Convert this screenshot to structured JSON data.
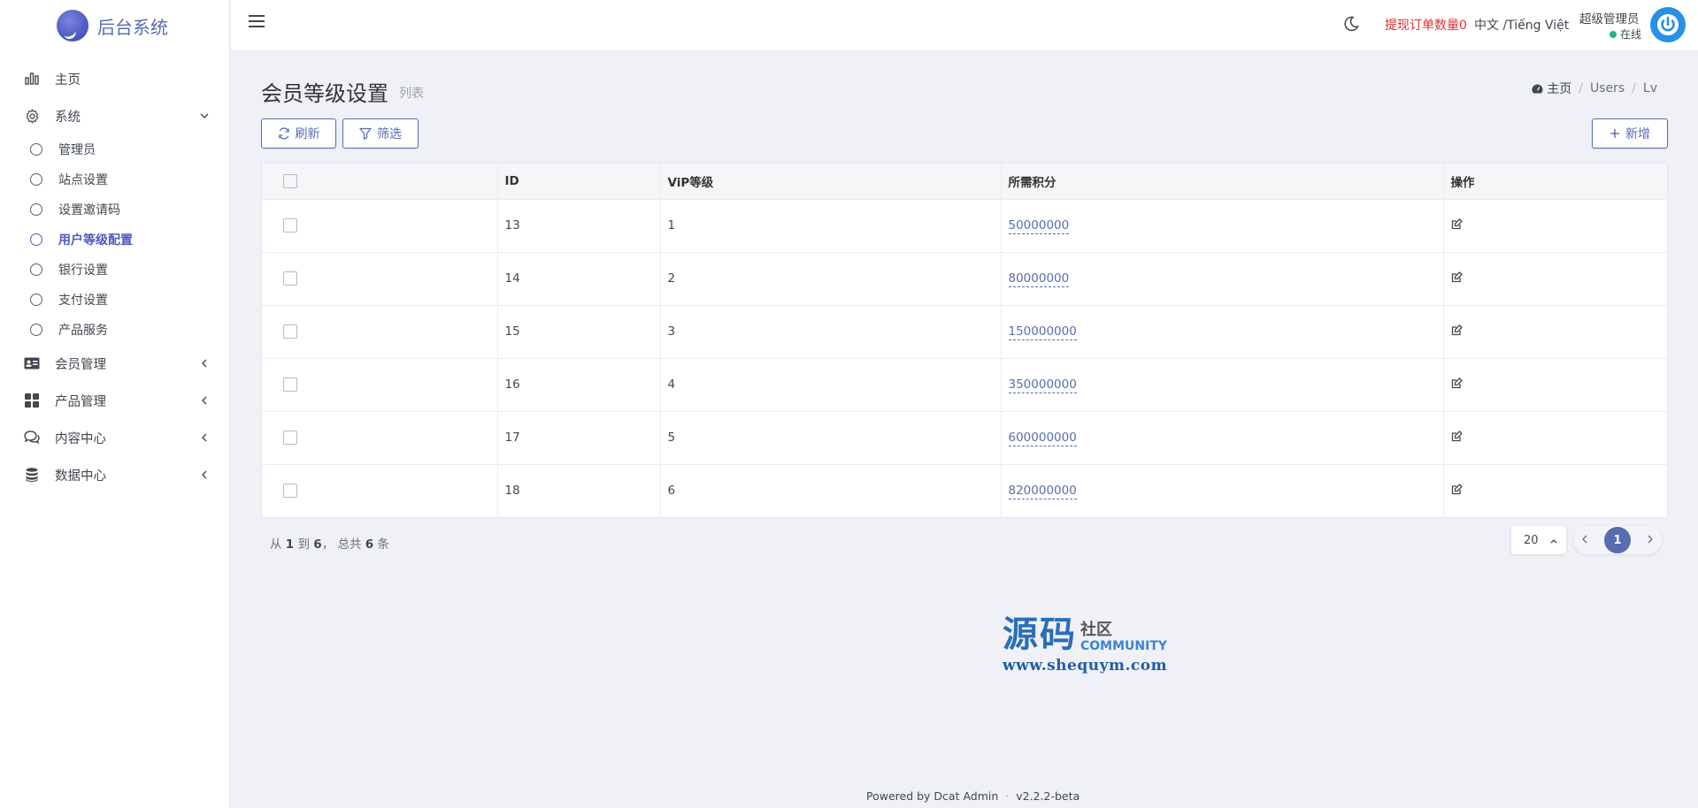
{
  "brand": {
    "name": "后台系统"
  },
  "sidebar": {
    "items": [
      {
        "label": "主页",
        "icon": "bar-chart-icon"
      },
      {
        "label": "系统",
        "icon": "gear-icon",
        "expanded": true,
        "children": [
          {
            "label": "管理员"
          },
          {
            "label": "站点设置"
          },
          {
            "label": "设置邀请码"
          },
          {
            "label": "用户等级配置",
            "active": true
          },
          {
            "label": "银行设置"
          },
          {
            "label": "支付设置"
          },
          {
            "label": "产品服务"
          }
        ]
      },
      {
        "label": "会员管理",
        "icon": "id-card-icon"
      },
      {
        "label": "产品管理",
        "icon": "grid-icon"
      },
      {
        "label": "内容中心",
        "icon": "chat-icon"
      },
      {
        "label": "数据中心",
        "icon": "database-icon"
      }
    ]
  },
  "header": {
    "withdraw_label": "提现订单数量0",
    "language": "中文 /Tiếng Việt",
    "user_name": "超级管理员",
    "user_status": "在线"
  },
  "page": {
    "title": "会员等级设置",
    "subtitle": "列表",
    "breadcrumb": [
      "主页",
      "Users",
      "Lv"
    ]
  },
  "toolbar": {
    "refresh_label": "刷新",
    "filter_label": "筛选",
    "new_label": "新增"
  },
  "table": {
    "columns": [
      "ID",
      "ViP等级",
      "所需积分",
      "操作"
    ],
    "rows": [
      {
        "id": "13",
        "level": "1",
        "points": "50000000"
      },
      {
        "id": "14",
        "level": "2",
        "points": "80000000"
      },
      {
        "id": "15",
        "level": "3",
        "points": "150000000"
      },
      {
        "id": "16",
        "level": "4",
        "points": "350000000"
      },
      {
        "id": "17",
        "level": "5",
        "points": "600000000"
      },
      {
        "id": "18",
        "level": "6",
        "points": "820000000"
      }
    ]
  },
  "pagination": {
    "summary_from": "从",
    "from": "1",
    "summary_to": "到",
    "to": "6",
    "summary_total": "，  总共",
    "total": "6",
    "summary_unit": "条",
    "per_page": "20",
    "current_page": "1"
  },
  "watermark": {
    "big": "源码",
    "cn": "社区",
    "en": "COMMUNITY",
    "url": "www.shequym.com"
  },
  "footer": {
    "powered": "Powered by Dcat Admin",
    "version": "v2.2.2-beta"
  },
  "colors": {
    "accent": "#586cb1",
    "background": "#eff1f6",
    "withdraw": "#e52d2d",
    "online": "#21b978"
  }
}
